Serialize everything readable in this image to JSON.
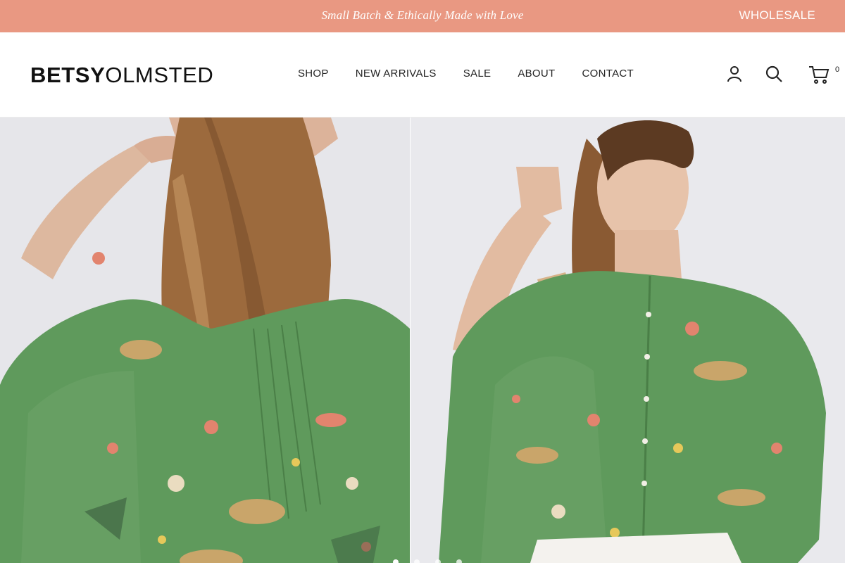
{
  "announcement": {
    "text": "Small Batch & Ethically Made with Love",
    "wholesale_label": "WHOLESALE",
    "background": "#e99882"
  },
  "header": {
    "logo_bold": "BETSY",
    "logo_light": "OLMSTED",
    "nav": [
      "SHOP",
      "NEW ARRIVALS",
      "SALE",
      "ABOUT",
      "CONTACT"
    ],
    "icons": [
      "account-icon",
      "search-icon",
      "cart-icon"
    ],
    "cart_count": "0"
  },
  "hero": {
    "slides": [
      {
        "image": "model-back-view-green-jungle-print-blouse"
      },
      {
        "image": "model-front-view-green-jungle-print-blouse"
      }
    ],
    "colors": {
      "blouse": "#5f9a5c",
      "background": "#e6e6ea"
    }
  }
}
